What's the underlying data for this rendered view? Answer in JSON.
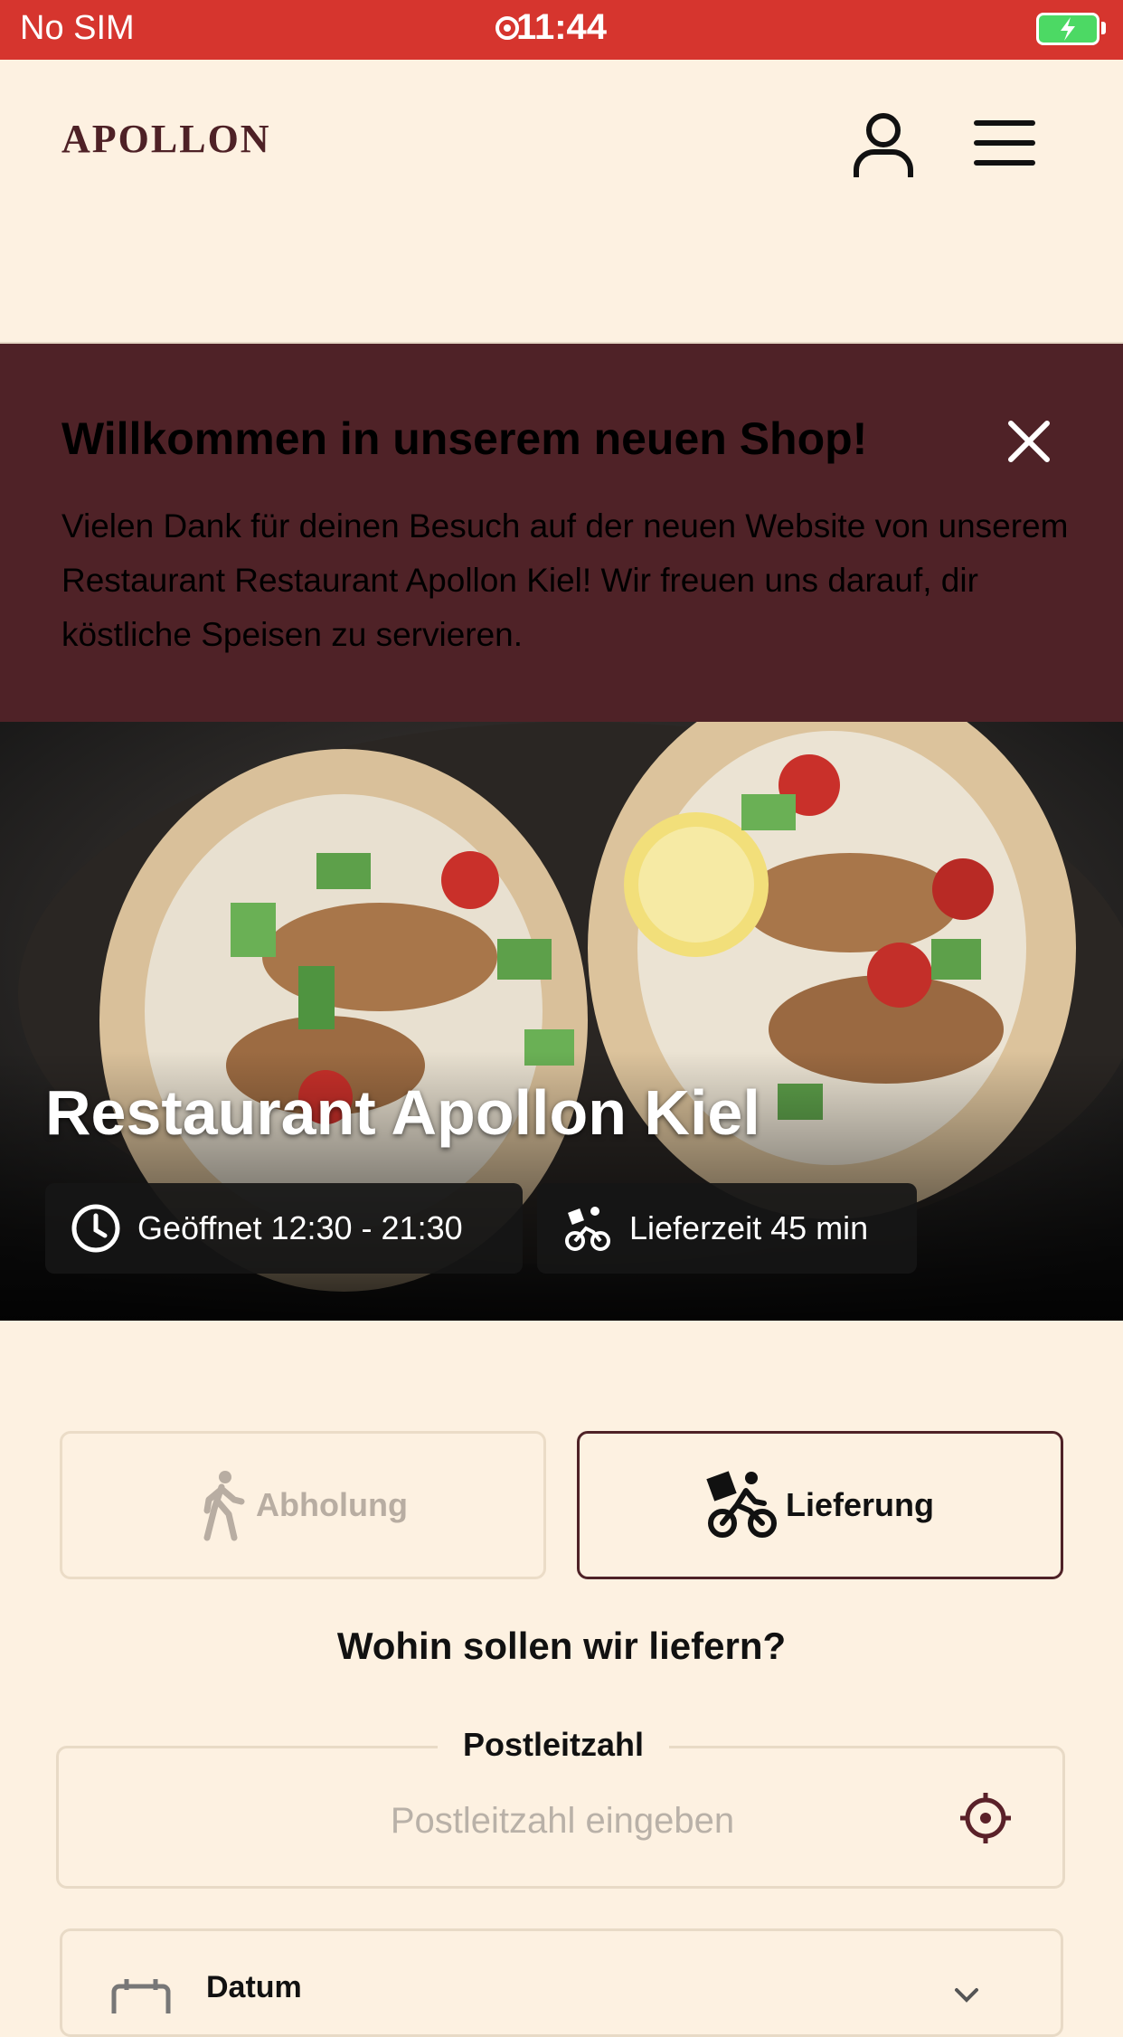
{
  "status_bar": {
    "carrier": "No SIM",
    "time": "11:44"
  },
  "header": {
    "logo": "APOLLON"
  },
  "banner": {
    "title": "Willkommen in unserem neuen Shop!",
    "text": "Vielen Dank für deinen Besuch auf der neuen Website von unserem Restaurant Restaurant Apollon Kiel! Wir freuen uns darauf, dir köstliche Speisen zu servieren."
  },
  "hero": {
    "title": "Restaurant Apollon Kiel",
    "opening_hours": "Geöffnet 12:30 - 21:30",
    "delivery_time": "Lieferzeit 45 min"
  },
  "order_mode": {
    "pickup_label": "Abholung",
    "delivery_label": "Lieferung",
    "selected": "delivery"
  },
  "delivery_question": "Wohin sollen wir liefern?",
  "postal": {
    "label": "Postleitzahl",
    "placeholder": "Postleitzahl eingeben",
    "value": ""
  },
  "date": {
    "label": "Datum"
  },
  "colors": {
    "status_bar": "#d6352e",
    "background": "#fdf1e1",
    "brand_dark": "#4f2227",
    "accent_icon": "#5a2129"
  }
}
